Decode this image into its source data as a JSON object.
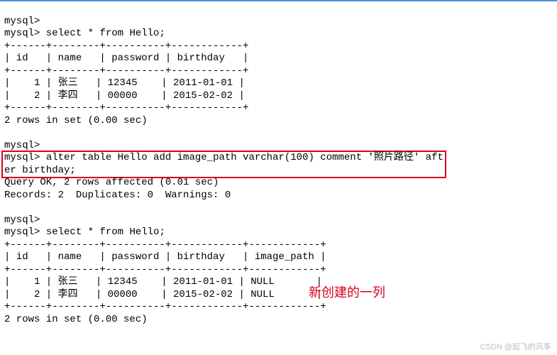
{
  "prompt": "mysql>",
  "queries": {
    "select1": "select * from Hello;",
    "alter": "alter table Hello add image_path varchar(100) comment '照片路径' aft",
    "alter_wrap": "er birthday;",
    "select2": "select * from Hello;"
  },
  "results": {
    "query_ok": "Query OK, 2 rows affected (0.01 sec)",
    "records": "Records: 2  Duplicates: 0  Warnings: 0",
    "rows_in_set": "2 rows in set (0.00 sec)"
  },
  "table1": {
    "border_top": "+------+--------+----------+------------+",
    "header": "| id   | name   | password | birthday   |",
    "border_mid": "+------+--------+----------+------------+",
    "row1": "|    1 | 张三   | 12345    | 2011-01-01 |",
    "row2": "|    2 | 李四   | 00000    | 2015-02-02 |",
    "border_bot": "+------+--------+----------+------------+"
  },
  "table2": {
    "border_top": "+------+--------+----------+------------+------------+",
    "header": "| id   | name   | password | birthday   | image_path |",
    "border_mid": "+------+--------+----------+------------+------------+",
    "row1": "|    1 | 张三   | 12345    | 2011-01-01 | NULL       |",
    "row2": "|    2 | 李四   | 00000    | 2015-02-02 | NULL       |",
    "border_bot": "+------+--------+----------+------------+------------+"
  },
  "annotation": "新创建的一列",
  "watermark": "CSDN @起飞的风筝",
  "chart_data": {
    "type": "table",
    "before": {
      "columns": [
        "id",
        "name",
        "password",
        "birthday"
      ],
      "rows": [
        [
          1,
          "张三",
          "12345",
          "2011-01-01"
        ],
        [
          2,
          "李四",
          "00000",
          "2015-02-02"
        ]
      ]
    },
    "after": {
      "columns": [
        "id",
        "name",
        "password",
        "birthday",
        "image_path"
      ],
      "rows": [
        [
          1,
          "张三",
          "12345",
          "2011-01-01",
          "NULL"
        ],
        [
          2,
          "李四",
          "00000",
          "2015-02-02",
          "NULL"
        ]
      ]
    }
  }
}
